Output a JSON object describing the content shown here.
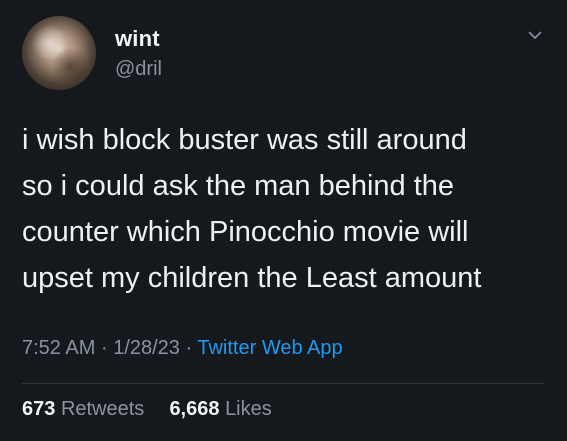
{
  "author": {
    "name": "wint",
    "handle": "@dril"
  },
  "tweet": {
    "text": "i wish block buster was still around\nso i could ask the man behind the\ncounter which Pinocchio movie will\nupset my children the Least amount",
    "time": "7:52 AM",
    "date": "1/28/23",
    "separator": "·",
    "source": "Twitter Web App"
  },
  "stats": {
    "retweets_count": "673",
    "retweets_label": "Retweets",
    "likes_count": "6,668",
    "likes_label": "Likes"
  },
  "icons": {
    "menu": "chevron-down-icon"
  },
  "colors": {
    "background": "#15181d",
    "link": "#1d9bf0",
    "muted": "#8b949e"
  }
}
